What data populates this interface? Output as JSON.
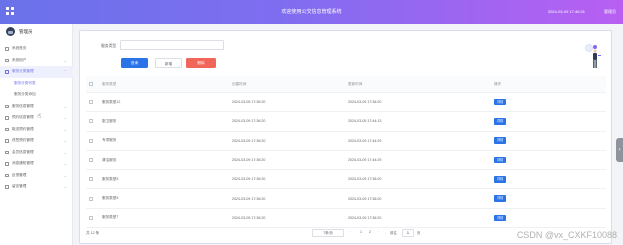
{
  "header": {
    "title": "欢迎使用公交信息管理系统",
    "datetime": "2024-03-09 17:46:31",
    "user": "管理员"
  },
  "sidebar": {
    "brand": "管理员",
    "items": [
      {
        "label": "系统首页"
      },
      {
        "label": "系统用户"
      },
      {
        "label": "服务分类管理",
        "open": true,
        "children": [
          {
            "label": "服务分类列表",
            "active": true
          },
          {
            "label": "服务分类添加"
          }
        ]
      },
      {
        "label": "服务信息管理"
      },
      {
        "label": "预约信息管理"
      },
      {
        "label": "取送预约管理"
      },
      {
        "label": "改签预约管理"
      },
      {
        "label": "会员信息管理"
      },
      {
        "label": "消息通知管理"
      },
      {
        "label": "反馈管理"
      },
      {
        "label": "留言管理"
      }
    ]
  },
  "search": {
    "label": "服务类型",
    "value": "",
    "placeholder": ""
  },
  "buttons": {
    "query": "查询",
    "add": "新增",
    "delete": "删除"
  },
  "table": {
    "columns": [
      "服务类型",
      "创建时间",
      "更新时间",
      "操作"
    ],
    "rows": [
      {
        "name": "服务类型12",
        "created": "2024-03-09 17:36:20",
        "updated": "2024-03-09 17:36:20",
        "action": "详情"
      },
      {
        "name": "厨卫服务",
        "created": "2024-03-09 17:36:20",
        "updated": "2024-03-09 17:44:13",
        "action": "详情"
      },
      {
        "name": "专项服务",
        "created": "2024-03-09 17:36:20",
        "updated": "2024-03-09 17:44:29",
        "action": "详情"
      },
      {
        "name": "清洁服务",
        "created": "2024-03-09 17:36:20",
        "updated": "2024-03-09 17:44:29",
        "action": "详情"
      },
      {
        "name": "服务类型5",
        "created": "2024-03-09 17:36:20",
        "updated": "2024-03-09 17:36:20",
        "action": "详情"
      },
      {
        "name": "服务类型5",
        "created": "2024-03-09 17:36:20",
        "updated": "2024-03-09 17:36:20",
        "action": "详情"
      },
      {
        "name": "服务类型7",
        "created": "2024-03-09 17:36:20",
        "updated": "2024-03-09 17:36:20",
        "action": "详情"
      }
    ]
  },
  "pagination": {
    "total": "共 12 条",
    "page_size": "7条/页",
    "prev": "‹",
    "pages": [
      "1",
      "2"
    ],
    "next": "›",
    "goto_prefix": "前往",
    "goto_value": "1",
    "goto_suffix": "页"
  },
  "overlay": {
    "side_arrow": "›",
    "watermark": "CSDN @vx_CXKF10088"
  },
  "colors": {
    "primary": "#2b74e8",
    "danger": "#f2665a",
    "accent": "#6f73ea"
  },
  "icons": [
    "grid-icon",
    "home-icon",
    "user-icon",
    "folder-icon",
    "chevron-down-icon",
    "chevron-up-icon",
    "pointer-cursor-icon",
    "chevron-right-icon"
  ]
}
